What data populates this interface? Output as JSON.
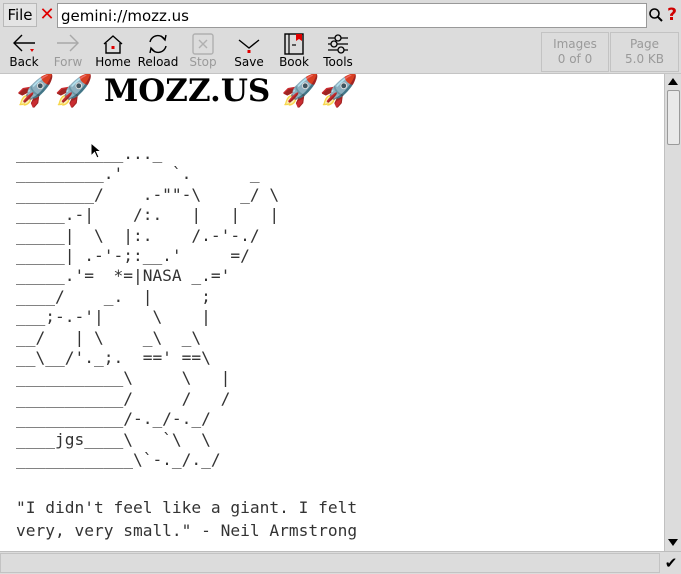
{
  "topbar": {
    "file_label": "File",
    "url_value": "gemini://mozz.us",
    "help_label": "?"
  },
  "toolbar": {
    "back": "Back",
    "forward": "Forw",
    "home": "Home",
    "reload": "Reload",
    "stop": "Stop",
    "save": "Save",
    "book": "Book",
    "tools": "Tools"
  },
  "stats": {
    "images_label": "Images",
    "images_value": "0 of 0",
    "page_label": "Page",
    "page_value": "5.0 KB"
  },
  "page": {
    "heading": "🚀🚀 MOZZ.US 🚀🚀",
    "ascii_art": "___________..._\n_________.'     `.      _\n________/    .-\"\"-\\    _/ \\\n_____.-|    /:.   |   |   |\n_____|  \\  |:.    /.-'-./\n_____| .-'-;:__.'     =/\n_____.'=  *=|NASA _.='\n____/    _.  |     ;\n___;-.-'|     \\    |\n__/   | \\    _\\  _\\\n__\\__/'._;.  ==' ==\\\n___________\\     \\   |\n___________/     /   /\n___________/-._/-._/\n____jgs____\\   `\\  \\\n____________\\`-._/._/",
    "quote": "\"I didn't feel like a giant. I felt\nvery, very small.\" - Neil Armstrong"
  },
  "statusbar": {
    "text": "",
    "check": "✔"
  }
}
